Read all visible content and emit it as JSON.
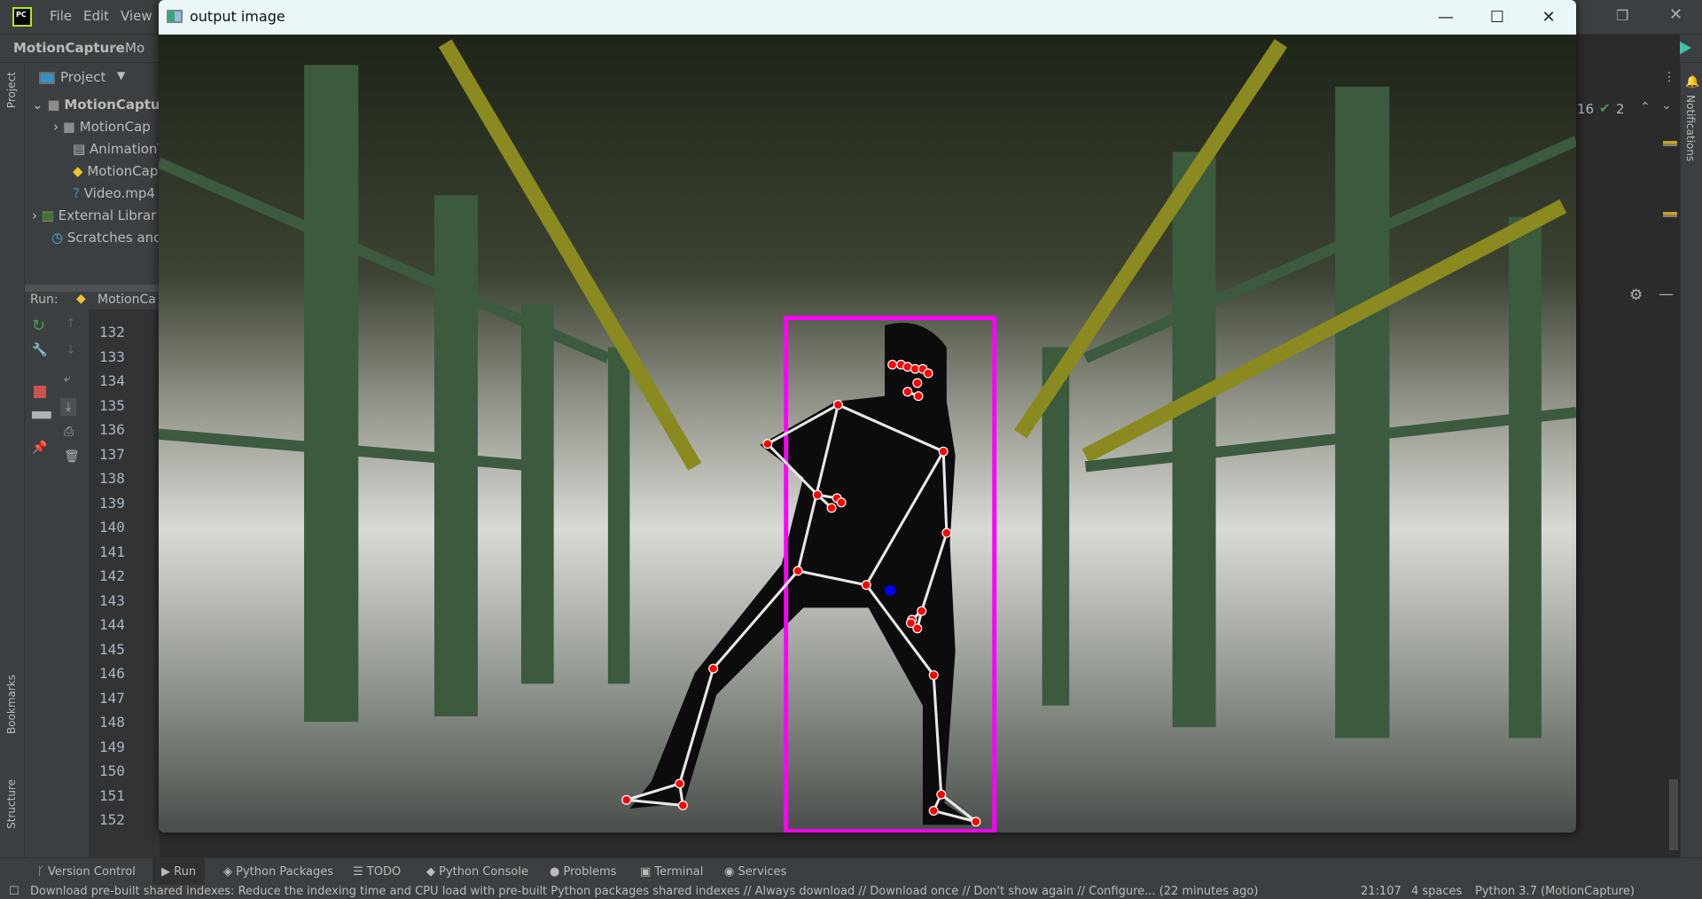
{
  "ide": {
    "menu": [
      "File",
      "Edit",
      "View"
    ],
    "breadcrumb": [
      "MotionCapture",
      "Mo"
    ],
    "left_stripe": {
      "project": "Project",
      "bookmarks": "Bookmarks",
      "structure": "Structure"
    },
    "project_panel": {
      "title": "Project",
      "tree": [
        {
          "label": "MotionCaptur",
          "icon": "folder-icon",
          "expanded": true
        },
        {
          "label": "MotionCap",
          "icon": "folder-icon"
        },
        {
          "label": "AnimationT",
          "icon": "text-file-icon"
        },
        {
          "label": "MotionCap",
          "icon": "python-file-icon"
        },
        {
          "label": "Video.mp4",
          "icon": "unknown-file-icon"
        },
        {
          "label": "External Librar",
          "icon": "library-icon"
        },
        {
          "label": "Scratches and",
          "icon": "scratches-icon"
        }
      ]
    },
    "run": {
      "label": "Run:",
      "config": "MotionCa",
      "line_numbers": [
        "132",
        "133",
        "134",
        "135",
        "136",
        "137",
        "138",
        "139",
        "140",
        "141",
        "142",
        "143",
        "144",
        "145",
        "146",
        "147",
        "148",
        "149",
        "150",
        "151",
        "152"
      ]
    },
    "editor_right": {
      "warnings": "16",
      "checks": "2"
    },
    "notifications": "Notifications",
    "bottom_tabs": [
      "Version Control",
      "Run",
      "Python Packages",
      "TODO",
      "Python Console",
      "Problems",
      "Terminal",
      "Services"
    ],
    "status": {
      "message": "Download pre-built shared indexes: Reduce the indexing time and CPU load with pre-built Python packages shared indexes // Always download // Download once // Don't show again // Configure... (22 minutes ago)",
      "position": "21:107",
      "indent": "4 spaces",
      "interpreter": "Python 3.7 (MotionCapture)"
    },
    "colors": {
      "accent_stop": "#c75450",
      "update": "#f0a732",
      "bbox": "#ff00ff",
      "keypoint": "#ff0000",
      "center": "#0000ff"
    }
  },
  "window": {
    "title": "output image",
    "controls": [
      "minimize",
      "maximize",
      "close"
    ]
  }
}
